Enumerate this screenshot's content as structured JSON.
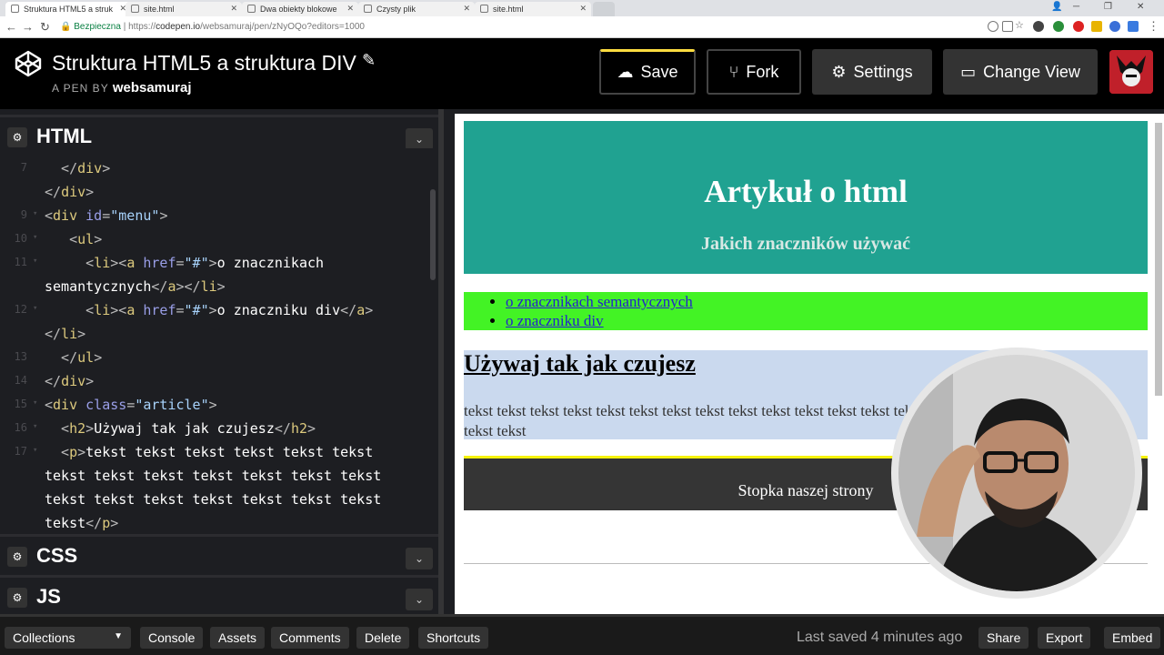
{
  "browser": {
    "tabs": [
      {
        "label": "Struktura HTML5 a struk",
        "active": true
      },
      {
        "label": "site.html",
        "active": false
      },
      {
        "label": "Dwa obiekty blokowe",
        "active": false
      },
      {
        "label": "Czysty plik",
        "active": false
      },
      {
        "label": "site.html",
        "active": false
      }
    ],
    "secure_label": "Bezpieczna",
    "url_prefix": "https://",
    "url_host": "codepen.io",
    "url_path": "/websamuraj/pen/zNyOQo?editors=1000"
  },
  "header": {
    "title": "Struktura HTML5 a struktura DIV",
    "by_label": "A PEN BY",
    "author": "websamuraj",
    "buttons": {
      "save": "Save",
      "fork": "Fork",
      "settings": "Settings",
      "change_view": "Change View"
    }
  },
  "editors": {
    "html_title": "HTML",
    "css_title": "CSS",
    "js_title": "JS"
  },
  "code_lines": [
    {
      "n": "7",
      "fold": "",
      "html": "<span class='t'>  &lt;/</span><span class='tg'>div</span><span class='t'>&gt;</span>"
    },
    {
      "n": "",
      "fold": "",
      "html": "<span class='t'>&lt;/</span><span class='tg'>div</span><span class='t'>&gt;</span>"
    },
    {
      "n": "9",
      "fold": "▾",
      "html": "<span class='t'>&lt;</span><span class='tg'>div</span> <span class='at'>id</span><span class='t'>=</span><span class='av'>\"menu\"</span><span class='t'>&gt;</span>"
    },
    {
      "n": "10",
      "fold": "▾",
      "html": "<span class='t'>   &lt;</span><span class='tg'>ul</span><span class='t'>&gt;</span>"
    },
    {
      "n": "11",
      "fold": "▾",
      "html": "<span class='t'>     &lt;</span><span class='tg'>li</span><span class='t'>&gt;&lt;</span><span class='tg'>a</span> <span class='at'>href</span><span class='t'>=</span><span class='av'>\"#\"</span><span class='t'>&gt;</span>o znacznikach"
    },
    {
      "n": "",
      "fold": "",
      "html": "semantycznych<span class='t'>&lt;/</span><span class='tg'>a</span><span class='t'>&gt;&lt;/</span><span class='tg'>li</span><span class='t'>&gt;</span>"
    },
    {
      "n": "12",
      "fold": "▾",
      "html": "<span class='t'>     &lt;</span><span class='tg'>li</span><span class='t'>&gt;&lt;</span><span class='tg'>a</span> <span class='at'>href</span><span class='t'>=</span><span class='av'>\"#\"</span><span class='t'>&gt;</span>o znaczniku div<span class='t'>&lt;/</span><span class='tg'>a</span><span class='t'>&gt;</span>"
    },
    {
      "n": "",
      "fold": "",
      "html": "<span class='t'>&lt;/</span><span class='tg'>li</span><span class='t'>&gt;</span>"
    },
    {
      "n": "13",
      "fold": "",
      "html": "<span class='t'>  &lt;/</span><span class='tg'>ul</span><span class='t'>&gt;</span>"
    },
    {
      "n": "14",
      "fold": "",
      "html": "<span class='t'>&lt;/</span><span class='tg'>div</span><span class='t'>&gt;</span>"
    },
    {
      "n": "15",
      "fold": "▾",
      "html": "<span class='t'>&lt;</span><span class='tg'>div</span> <span class='at'>class</span><span class='t'>=</span><span class='av'>\"article\"</span><span class='t'>&gt;</span>"
    },
    {
      "n": "16",
      "fold": "▾",
      "html": "<span class='t'>  &lt;</span><span class='tg'>h2</span><span class='t'>&gt;</span>Używaj tak jak czujesz<span class='t'>&lt;/</span><span class='tg'>h2</span><span class='t'>&gt;</span>"
    },
    {
      "n": "17",
      "fold": "▾",
      "html": "<span class='t'>  &lt;</span><span class='tg'>p</span><span class='t'>&gt;</span>tekst tekst tekst tekst tekst tekst"
    },
    {
      "n": "",
      "fold": "",
      "html": "tekst tekst tekst tekst tekst tekst tekst"
    },
    {
      "n": "",
      "fold": "",
      "html": "tekst tekst tekst tekst tekst tekst tekst"
    },
    {
      "n": "",
      "fold": "",
      "html": "tekst<span class='t'>&lt;/</span><span class='tg'>p</span><span class='t'>&gt;</span>"
    }
  ],
  "preview": {
    "h1": "Artykuł o html",
    "h2": "Jakich znaczników używać",
    "menu_links": [
      "o znacznikach semantycznych",
      "o znaczniku div"
    ],
    "article_heading": "Używaj tak jak czujesz",
    "article_text": "tekst tekst tekst tekst tekst tekst tekst tekst tekst tekst tekst tekst tekst tekst tekst tekst tekst tekst tekst tekst tekst tekst",
    "footer_text": "Stopka naszej strony"
  },
  "footer": {
    "collections": "Collections",
    "console": "Console",
    "assets": "Assets",
    "comments": "Comments",
    "delete": "Delete",
    "shortcuts": "Shortcuts",
    "status": "Last saved 4 minutes ago",
    "share": "Share",
    "export": "Export",
    "embed": "Embed"
  },
  "colors": {
    "header_bg": "#20a291",
    "menu_bg": "#43f325",
    "article_bg": "#cad9ee",
    "footer_bg": "#353535",
    "footer_border": "#f7f20c",
    "save_accent": "#ffdd40"
  }
}
